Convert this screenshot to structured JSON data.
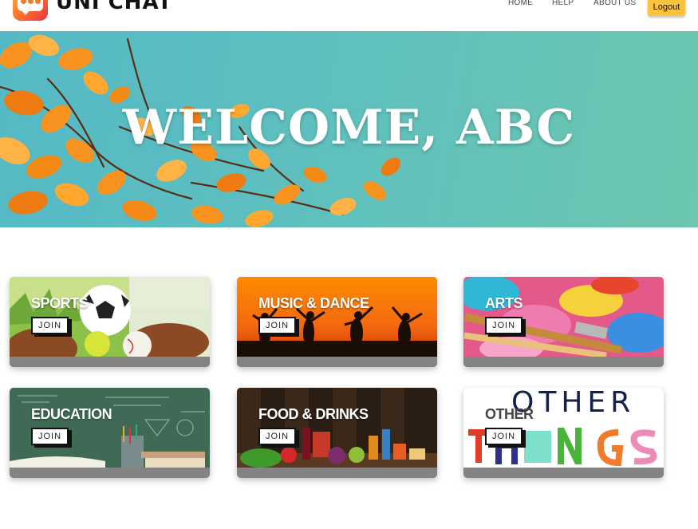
{
  "brand": {
    "name": "UNI CHAT",
    "logo_icon": "chat-group-icon"
  },
  "nav": {
    "home": "HOME",
    "help": "HELP",
    "about": "ABOUT US",
    "logout": "Logout"
  },
  "hero": {
    "title": "WELCOME, ABC"
  },
  "categories": [
    {
      "title": "SPORTS",
      "join": "JOIN"
    },
    {
      "title": "MUSIC & DANCE",
      "join": "JOIN"
    },
    {
      "title": "ARTS",
      "join": "JOIN"
    },
    {
      "title": "EDUCATION",
      "join": "JOIN"
    },
    {
      "title": "FOOD & DRINKS",
      "join": "JOIN"
    },
    {
      "title": "OTHER",
      "join": "JOIN",
      "image_text_top": "OTHER",
      "image_text_bottom": "THINGS"
    }
  ],
  "colors": {
    "accent": "#ffc23c",
    "hero": "#5cbec0",
    "card_footer": "#838383"
  }
}
